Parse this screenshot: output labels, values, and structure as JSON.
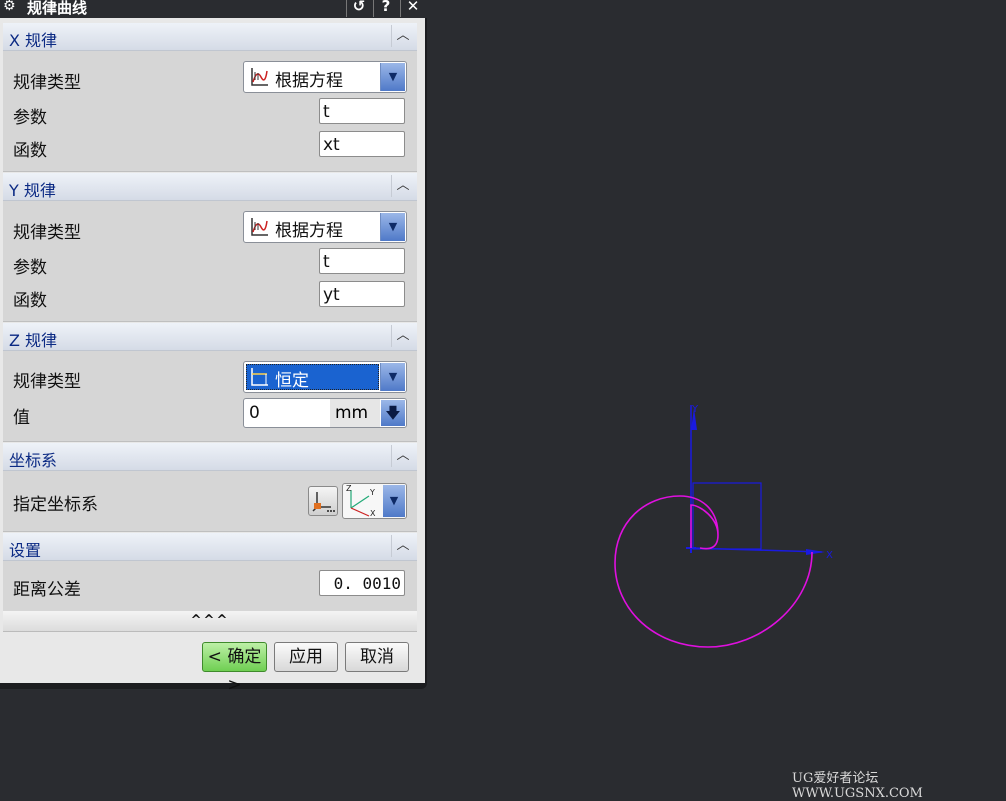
{
  "window": {
    "title": "规律曲线",
    "reset_label": "↺",
    "help_label": "?",
    "close_label": "✕"
  },
  "sections": {
    "x": {
      "title": "X 规律",
      "law_type_label": "规律类型",
      "law_type_value": "根据方程",
      "param_label": "参数",
      "param_value": "t",
      "func_label": "函数",
      "func_value": "xt"
    },
    "y": {
      "title": "Y 规律",
      "law_type_label": "规律类型",
      "law_type_value": "根据方程",
      "param_label": "参数",
      "param_value": "t",
      "func_label": "函数",
      "func_value": "yt"
    },
    "z": {
      "title": "Z 规律",
      "law_type_label": "规律类型",
      "law_type_value": "恒定",
      "value_label": "值",
      "value_value": "0",
      "unit": "mm"
    },
    "csys": {
      "title": "坐标系",
      "specify_label": "指定坐标系"
    },
    "settings": {
      "title": "设置",
      "tolerance_label": "距离公差",
      "tolerance_value": "0. 0010"
    }
  },
  "expander_label": "^^^",
  "buttons": {
    "ok": "< 确定 >",
    "apply": "应用",
    "cancel": "取消"
  },
  "viewport": {
    "axis_x_label": "X",
    "axis_y_label": "Y",
    "curve_color": "#e010e0",
    "axis_color": "#1a1ae0"
  },
  "watermark": "UG爱好者论坛 WWW.UGSNX.COM"
}
